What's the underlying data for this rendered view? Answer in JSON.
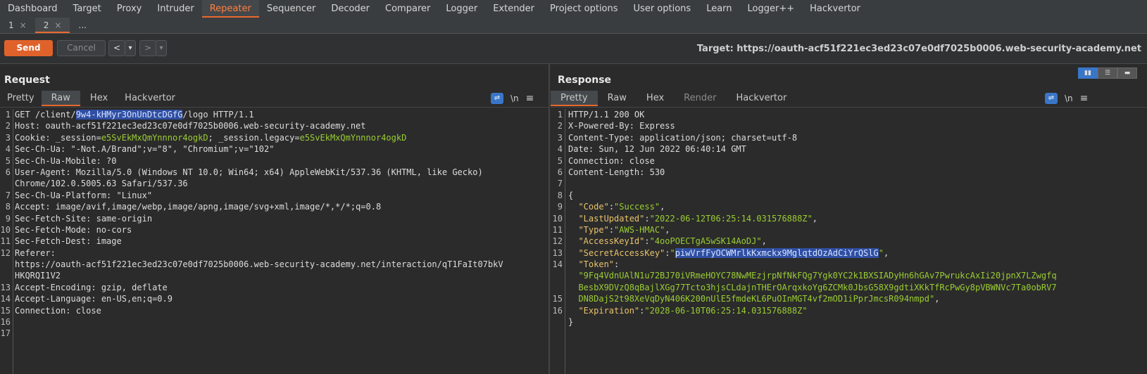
{
  "menu": [
    "Dashboard",
    "Target",
    "Proxy",
    "Intruder",
    "Repeater",
    "Sequencer",
    "Decoder",
    "Comparer",
    "Logger",
    "Extender",
    "Project options",
    "User options",
    "Learn",
    "Logger++",
    "Hackvertor"
  ],
  "subtabs": {
    "t1": "1",
    "t2": "2",
    "more": "...",
    "close": "×"
  },
  "toolbar": {
    "send": "Send",
    "cancel": "Cancel",
    "prev": "<",
    "next": ">",
    "drop": "▾",
    "target": "Target: https://oauth-acf51f221ec3ed23c07e0df7025b0006.web-security-academy.net"
  },
  "request": {
    "title": "Request",
    "tabs": [
      "Pretty",
      "Raw",
      "Hex",
      "Hackvertor"
    ],
    "line_numbers": [
      "1",
      "2",
      "3",
      "4",
      "5",
      "6",
      "",
      "7",
      "8",
      "9",
      "10",
      "11",
      "12",
      "",
      "",
      "13",
      "14",
      "15",
      "16",
      "17"
    ],
    "l1a": "GET /client/",
    "l1sel": "9w4-kHMyr3OnUnDtcDGfG",
    "l1b": "/logo HTTP/1.1",
    "l2": "Host: oauth-acf51f221ec3ed23c07e0df7025b0006.web-security-academy.net",
    "l3a": "Cookie: _session=",
    "l3b": "e5SvEkMxQmYnnnor4ogkD",
    "l3c": "; _session.legacy=",
    "l3d": "e5SvEkMxQmYnnnor4ogkD",
    "l4": "Sec-Ch-Ua: \"-Not.A/Brand\";v=\"8\", \"Chromium\";v=\"102\"",
    "l5": "Sec-Ch-Ua-Mobile: ?0",
    "l6a": "User-Agent: Mozilla/5.0 (Windows NT 10.0; Win64; x64) AppleWebKit/537.36 (KHTML, like Gecko)",
    "l6b": "Chrome/102.0.5005.63 Safari/537.36",
    "l7": "Sec-Ch-Ua-Platform: \"Linux\"",
    "l8": "Accept: image/avif,image/webp,image/apng,image/svg+xml,image/*,*/*;q=0.8",
    "l9": "Sec-Fetch-Site: same-origin",
    "l10": "Sec-Fetch-Mode: no-cors",
    "l11": "Sec-Fetch-Dest: image",
    "l12a": "Referer:",
    "l12b": "https://oauth-acf51f221ec3ed23c07e0df7025b0006.web-security-academy.net/interaction/qT1FaIt07bkV",
    "l12c": "HKQRQI1V2",
    "l13": "Accept-Encoding: gzip, deflate",
    "l14": "Accept-Language: en-US,en;q=0.9",
    "l15": "Connection: close"
  },
  "response": {
    "title": "Response",
    "tabs": [
      "Pretty",
      "Raw",
      "Hex",
      "Render",
      "Hackvertor"
    ],
    "line_numbers": [
      "1",
      "2",
      "3",
      "4",
      "5",
      "6",
      "7",
      "8",
      "9",
      "10",
      "11",
      "12",
      "13",
      "14",
      "",
      "",
      "15",
      "16"
    ],
    "r1": "HTTP/1.1 200 OK",
    "r2": "X-Powered-By: Express",
    "r3": "Content-Type: application/json; charset=utf-8",
    "r4": "Date: Sun, 12 Jun 2022 06:40:14 GMT",
    "r5": "Connection: close",
    "r6": "Content-Length: 530",
    "r8": "{",
    "k9": "\"Code\"",
    "v9": "\"Success\"",
    "k10": "\"LastUpdated\"",
    "v10": "\"2022-06-12T06:25:14.031576888Z\"",
    "k11": "\"Type\"",
    "v11": "\"AWS-HMAC\"",
    "k12": "\"AccessKeyId\"",
    "v12": "\"4ooPOECTgA5wSK14AoDJ\"",
    "k13": "\"SecretAccessKey\"",
    "q13": "\"",
    "v13": "piwVrfFyOCWMrlkKxmckx9MglqtdOzAdCiYrQSlG",
    "k14": "\"Token\"",
    "t1": "\"9Fq4VdnUAlN1u72BJ70iVRmeHOYC78NwMEzjrpNfNkFQg7Ygk0YC2k1BXSIADyHn6hGAv7PwrukcAxIi20jpnX7LZwgfq",
    "t2": "BesbX9DVzQ8qBajlXGg77Tcto3hjsCLdajnTHErOArqxkoYg6ZCMk0JbsG58X9gdtiXKkTfRcPwGy8pVBWNVc7Ta0obRV7",
    "t3": "DN8DajS2t98XeVqDyN406K200nUlE5fmdeKL6PuOInMGT4vf2mOD1iPprJmcsR094nmpd\"",
    "k15": "\"Expiration\"",
    "v15": "\"2028-06-10T06:25:14.031576888Z\"",
    "r16": "}",
    "colon": ":",
    "comma": ","
  },
  "icons": {
    "wrap": "⇌",
    "newline": "\\n",
    "menu": "≡"
  }
}
